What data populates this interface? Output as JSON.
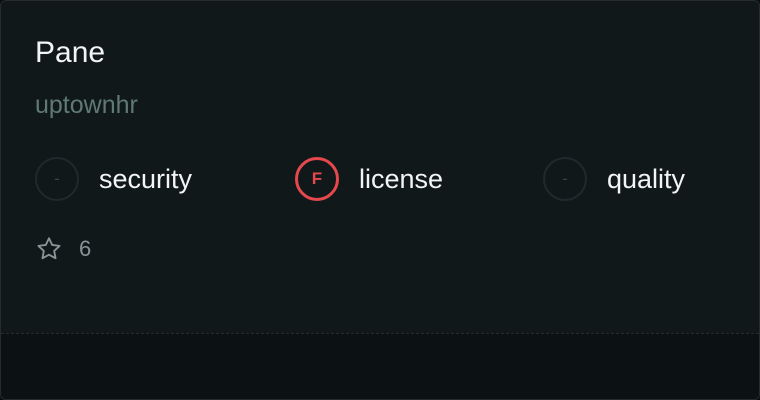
{
  "card": {
    "title": "Pane",
    "owner": "uptownhr",
    "metrics": [
      {
        "grade": "-",
        "label": "security",
        "status": "none"
      },
      {
        "grade": "F",
        "label": "license",
        "status": "fail"
      },
      {
        "grade": "-",
        "label": "quality",
        "status": "none"
      }
    ],
    "stars": {
      "icon": "star-icon",
      "count": "6"
    }
  },
  "colors": {
    "background": "#11181a",
    "title": "#f2f4f5",
    "owner": "#5f7a72",
    "fail": "#e5484d",
    "muted": "#8a9396"
  }
}
